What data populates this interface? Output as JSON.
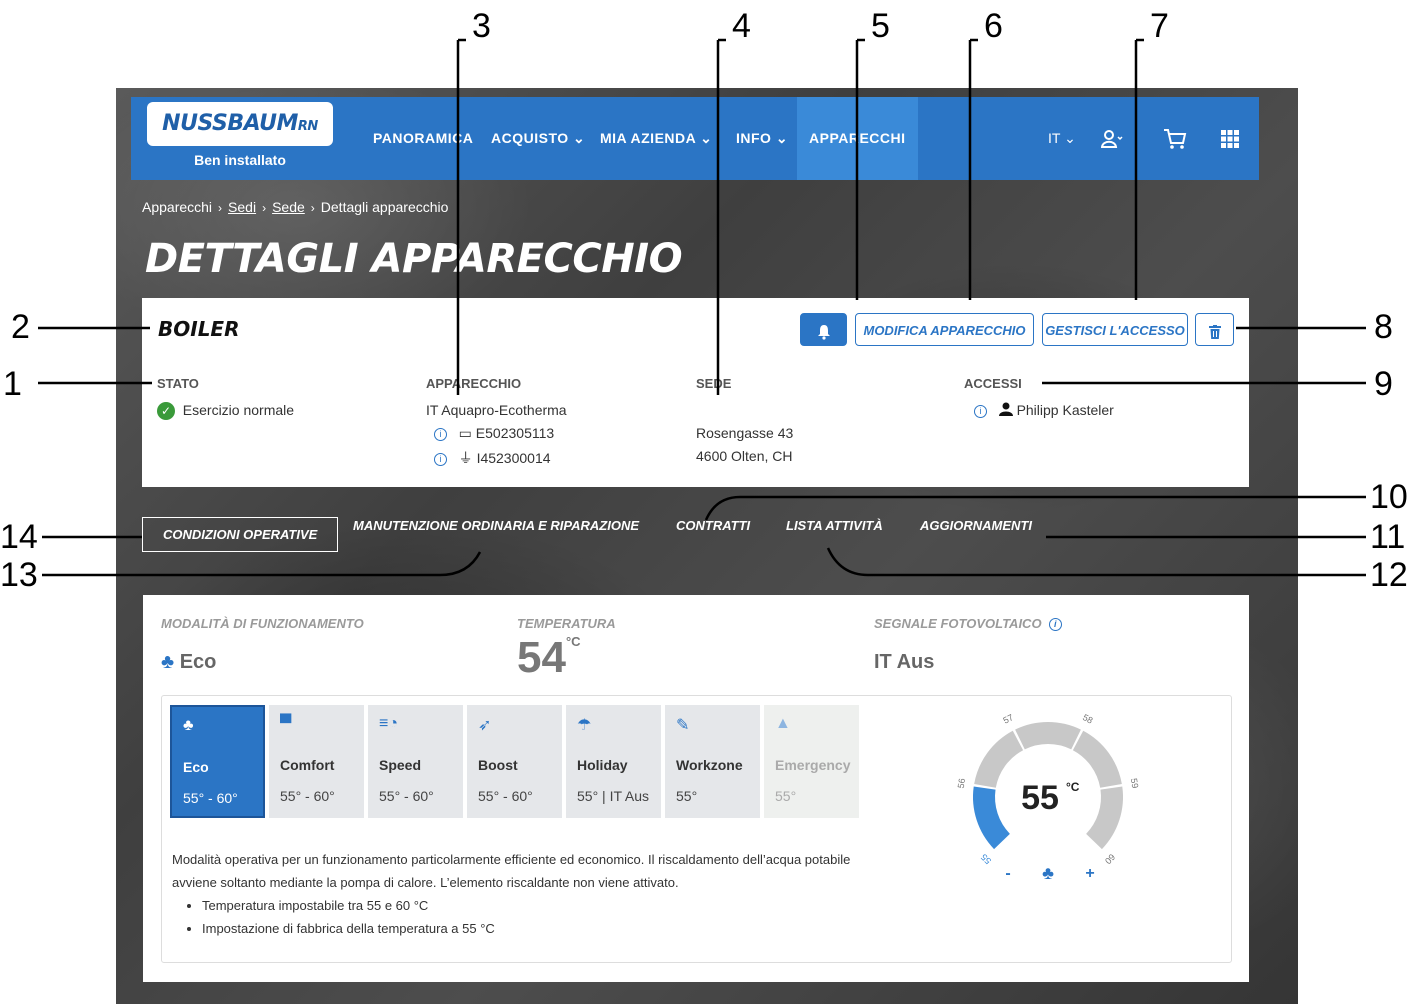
{
  "nav": {
    "logo": "NUSSBAUM",
    "logo_suffix": "RN",
    "tagline": "Ben installato",
    "items": [
      "PANORAMICA",
      "ACQUISTO",
      "MIA AZIENDA",
      "INFO",
      "APPARECCHI"
    ],
    "language": "IT"
  },
  "breadcrumb": [
    "Apparecchi",
    "Sedi",
    "Sede",
    "Dettagli apparecchio"
  ],
  "page_title": "DETTAGLI APPARECCHIO",
  "device": {
    "name": "BOILER",
    "buttons": {
      "modify": "MODIFICA APPARECCHIO",
      "access": "GESTISCI L'ACCESSO"
    },
    "status_label": "STATO",
    "status_value": "Esercizio normale",
    "appliance_label": "APPARECCHIO",
    "appliance_name": "IT Aquapro-Ecotherma",
    "serial_1": "E502305113",
    "serial_2": "I452300014",
    "site_label": "SEDE",
    "site_street": "Rosengasse 43",
    "site_city": "4600 Olten, CH",
    "access_label": "ACCESSI",
    "access_user": "Philipp Kasteler"
  },
  "tabs": [
    "CONDIZIONI OPERATIVE",
    "MANUTENZIONE ORDINARIA E RIPARAZIONE",
    "CONTRATTI",
    "LISTA ATTIVITÀ",
    "AGGIORNAMENTI"
  ],
  "operating": {
    "mode_label": "MODALITÀ DI FUNZIONAMENTO",
    "mode_value": "Eco",
    "temp_label": "TEMPERATURA",
    "temp_value": "54",
    "temp_unit": "°C",
    "pv_label": "SEGNALE FOTOVOLTAICO",
    "pv_value": "IT Aus",
    "modes": [
      {
        "name": "Eco",
        "range": "55° - 60°",
        "icon": "tree-icon",
        "glyph": "♣"
      },
      {
        "name": "Comfort",
        "range": "55° - 60°",
        "icon": "sofa-icon",
        "glyph": "▀"
      },
      {
        "name": "Speed",
        "range": "55° - 60°",
        "icon": "speed-icon",
        "glyph": "≡◔"
      },
      {
        "name": "Boost",
        "range": "55° - 60°",
        "icon": "rocket-icon",
        "glyph": "➶"
      },
      {
        "name": "Holiday",
        "range": "55° | IT Aus",
        "icon": "umbrella-icon",
        "glyph": "☂"
      },
      {
        "name": "Workzone",
        "range": "55°",
        "icon": "wrench-icon",
        "glyph": "✎"
      },
      {
        "name": "Emergency",
        "range": "55°",
        "icon": "bell-icon",
        "glyph": "▲"
      }
    ],
    "description": "Modalità operativa per un funzionamento particolarmente efficiente ed economico. Il riscaldamento dell’acqua potabile avviene soltanto mediante la pompa di calore. L’elemento riscaldante non viene attivato.",
    "bullets": [
      "Temperatura impostabile tra 55 e 60 °C",
      "Impostazione di fabbrica della temperatura a 55 °C"
    ],
    "dial": {
      "value": "55",
      "unit": "°C",
      "ticks": [
        "55",
        "56",
        "57",
        "58",
        "59",
        "60"
      ],
      "minus": "-",
      "plus": "+",
      "level": 55,
      "min": 55,
      "max": 60,
      "accent": "#3a8ad8",
      "track": "#c8c8c8"
    }
  },
  "callouts": [
    "1",
    "2",
    "3",
    "4",
    "5",
    "6",
    "7",
    "8",
    "9",
    "10",
    "11",
    "12",
    "13",
    "14"
  ],
  "colors": {
    "brand": "#2b75c5",
    "active_nav": "#3a8ad8",
    "ok": "#3a9a3a"
  }
}
